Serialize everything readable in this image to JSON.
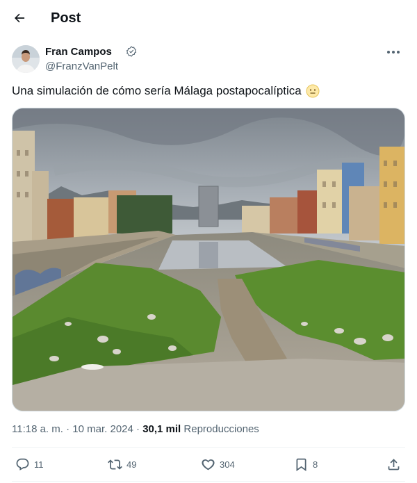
{
  "header": {
    "title": "Post",
    "back_icon": "arrow-left-icon"
  },
  "author": {
    "name": "Fran Campos",
    "handle": "@FranzVanPelt",
    "badge_icon": "verified-badge-icon",
    "more_icon": "more-horizontal-icon"
  },
  "tweet": {
    "text": "Una simulación de cómo sería Málaga postapocalíptica",
    "emoji": "neutral-face-emoji"
  },
  "meta": {
    "time": "11:18 a. m.",
    "separator1": " · ",
    "date": "10 mar. 2024",
    "separator2": " · ",
    "views": "30,1 mil",
    "views_label": " Reproducciones"
  },
  "actions": {
    "replies": "11",
    "reposts": "49",
    "likes": "304",
    "bookmarks": "8"
  },
  "colors": {
    "text": "#0f1419",
    "secondary": "#536471",
    "border": "#eff3f4"
  }
}
